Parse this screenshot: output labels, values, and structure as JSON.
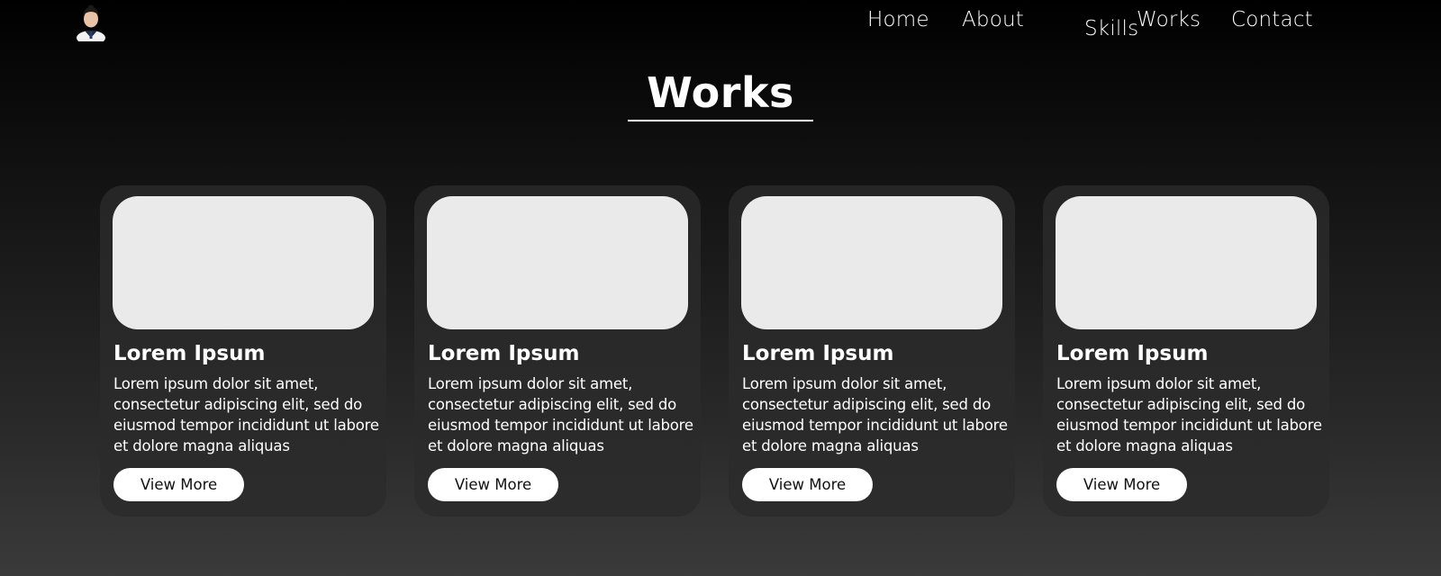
{
  "nav": {
    "links": [
      "Home",
      "About",
      "Skills",
      "Works",
      "Contact"
    ]
  },
  "section": {
    "title": "Works"
  },
  "cards": [
    {
      "title": "Lorem Ipsum",
      "description": "Lorem ipsum dolor sit amet, consectetur adipiscing elit, sed do eiusmod tempor incididunt ut labore et dolore magna aliquas",
      "button": "View More"
    },
    {
      "title": "Lorem Ipsum",
      "description": "Lorem ipsum dolor sit amet, consectetur adipiscing elit, sed do eiusmod tempor incididunt ut labore et dolore magna aliquas",
      "button": "View More"
    },
    {
      "title": "Lorem Ipsum",
      "description": "Lorem ipsum dolor sit amet, consectetur adipiscing elit, sed do eiusmod tempor incididunt ut labore et dolore magna aliquas",
      "button": "View More"
    },
    {
      "title": "Lorem Ipsum",
      "description": "Lorem ipsum dolor sit amet, consectetur adipiscing elit, sed do eiusmod tempor incididunt ut labore et dolore magna aliquas",
      "button": "View More"
    }
  ],
  "colors": {
    "card_bg": "#2a2a2a",
    "image_placeholder": "#eaeaea",
    "button_bg": "#ffffff",
    "text": "#ffffff"
  },
  "icons": {
    "avatar": "profile-avatar"
  }
}
